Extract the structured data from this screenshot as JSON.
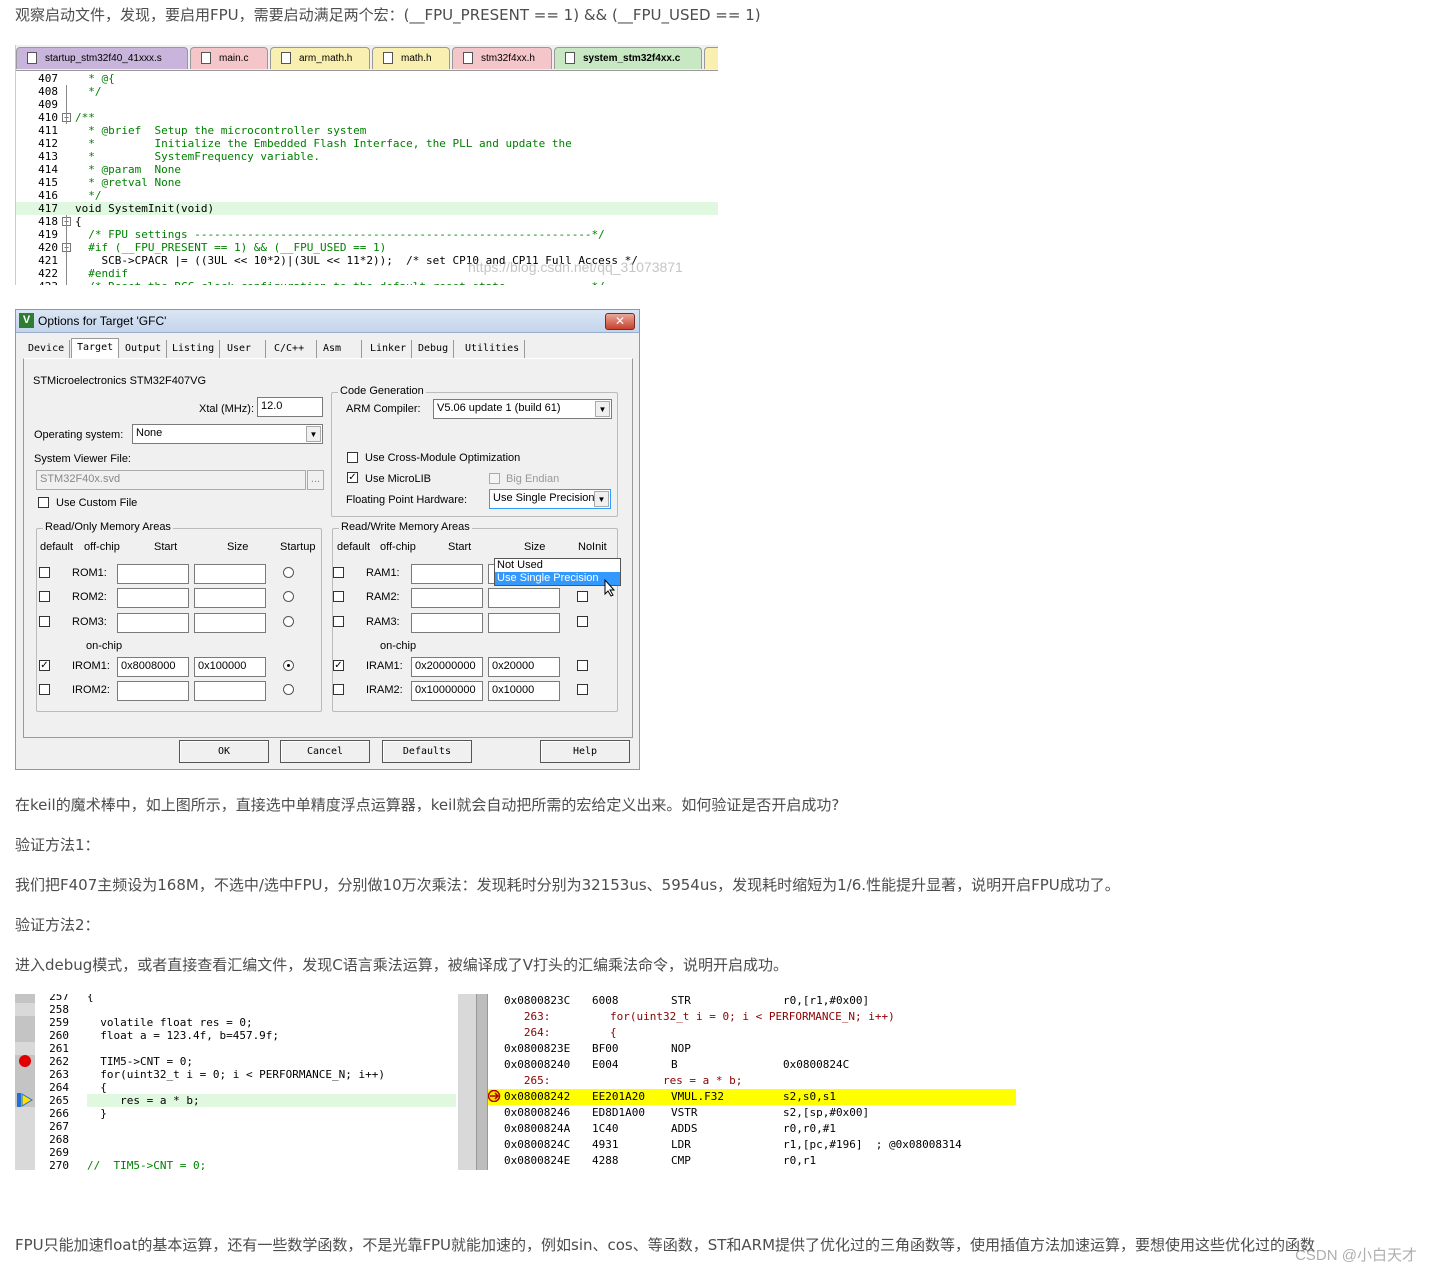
{
  "article": {
    "p1": "观察启动文件，发现，要启用FPU，需要启动满足两个宏：(__FPU_PRESENT == 1) && (__FPU_USED == 1)",
    "p2": "在keil的魔术棒中，如上图所示，直接选中单精度浮点运算器，keil就会自动把所需的宏给定义出来。如何验证是否开启成功?",
    "p3": "验证方法1：",
    "p4": "我们把F407主频设为168M，不选中/选中FPU，分别做10万次乘法：发现耗时分别为32153us、5954us，发现耗时缩短为1/6.性能提升显著，说明开启FPU成功了。",
    "p5": "验证方法2：",
    "p6": "进入debug模式，或者直接查看汇编文件，发现C语言乘法运算，被编译成了V打头的汇编乘法命令，说明开启成功。",
    "p7": "FPU只能加速float的基本运算，还有一些数学函数，不是光靠FPU就能加速的，例如sin、cos、等函数，ST和ARM提供了优化过的三角函数等，使用插值方法加速运算，要想使用这些优化过的函数",
    "watermark_csdn": "CSDN @小白天才",
    "watermark_url": "https://blog.csdn.net/qq_31073871"
  },
  "editor1": {
    "tabs": [
      {
        "label": "startup_stm32f40_41xxx.s",
        "color": "#c9b4dc"
      },
      {
        "label": "main.c",
        "color": "#f4c6c9"
      },
      {
        "label": "arm_math.h",
        "color": "#f9efb0"
      },
      {
        "label": "math.h",
        "color": "#f9efb0"
      },
      {
        "label": "stm32f4xx.h",
        "color": "#f4c6c9"
      },
      {
        "label": "system_stm32f4xx.c",
        "color": "#c8e8c4"
      }
    ],
    "lines": [
      {
        "n": "407",
        "t": "  * @{"
      },
      {
        "n": "408",
        "t": "  */"
      },
      {
        "n": "409",
        "t": ""
      },
      {
        "n": "410",
        "t": "/**"
      },
      {
        "n": "411",
        "t": "  * @brief  Setup the microcontroller system"
      },
      {
        "n": "412",
        "t": "  *         Initialize the Embedded Flash Interface, the PLL and update the"
      },
      {
        "n": "413",
        "t": "  *         SystemFrequency variable."
      },
      {
        "n": "414",
        "t": "  * @param  None"
      },
      {
        "n": "415",
        "t": "  * @retval None"
      },
      {
        "n": "416",
        "t": "  */"
      },
      {
        "n": "417",
        "t": "void SystemInit(void)"
      },
      {
        "n": "418",
        "t": "{"
      },
      {
        "n": "419",
        "t": "  /* FPU settings ------------------------------------------------------------*/"
      },
      {
        "n": "420",
        "t": "  #if (__FPU_PRESENT == 1) && (__FPU_USED == 1)"
      },
      {
        "n": "421",
        "t": "    SCB->CPACR |= ((3UL << 10*2)|(3UL << 11*2));  /* set CP10 and CP11 Full Access */"
      },
      {
        "n": "422",
        "t": "  #endif"
      },
      {
        "n": "423",
        "t": "  /* Reset the RCC clock configuration to the default reset state ------------*/"
      }
    ]
  },
  "dialog": {
    "title": "Options for Target 'GFC'",
    "close": "✕",
    "tabs": [
      "Device",
      "Target",
      "Output",
      "Listing",
      "User",
      "C/C++",
      "Asm",
      "Linker",
      "Debug",
      "Utilities"
    ],
    "device": "STMicroelectronics STM32F407VG",
    "xtal_label": "Xtal (MHz):",
    "xtal_value": "12.0",
    "os_label": "Operating system:",
    "os_value": "None",
    "svd_label": "System Viewer File:",
    "svd_value": "STM32F40x.svd",
    "svd_btn": "...",
    "custom_file": "Use Custom File",
    "codegen_title": "Code Generation",
    "compiler_label": "ARM Compiler:",
    "compiler_value": "V5.06 update 1 (build 61)",
    "cross_module": "Use Cross-Module Optimization",
    "microlib": "Use MicroLIB",
    "big_endian": "Big Endian",
    "fph_label": "Floating Point Hardware:",
    "fph_value": "Use Single Precision",
    "fph_options": [
      "Not Used",
      "Use Single Precision"
    ],
    "ro_title": "Read/Only Memory Areas",
    "rw_title": "Read/Write Memory Areas",
    "ro_headers": [
      "default",
      "off-chip",
      "Start",
      "Size",
      "Startup"
    ],
    "rw_headers": [
      "default",
      "off-chip",
      "Start",
      "Size",
      "NoInit"
    ],
    "on_chip": "on-chip",
    "ro_rows": [
      {
        "name": "ROM1:",
        "start": "",
        "size": ""
      },
      {
        "name": "ROM2:",
        "start": "",
        "size": ""
      },
      {
        "name": "ROM3:",
        "start": "",
        "size": ""
      },
      {
        "name": "IROM1:",
        "start": "0x8008000",
        "size": "0x100000"
      },
      {
        "name": "IROM2:",
        "start": "",
        "size": ""
      }
    ],
    "rw_rows": [
      {
        "name": "RAM1:",
        "start": "",
        "size": ""
      },
      {
        "name": "RAM2:",
        "start": "",
        "size": ""
      },
      {
        "name": "RAM3:",
        "start": "",
        "size": ""
      },
      {
        "name": "IRAM1:",
        "start": "0x20000000",
        "size": "0x20000"
      },
      {
        "name": "IRAM2:",
        "start": "0x10000000",
        "size": "0x10000"
      }
    ],
    "btn_ok": "OK",
    "btn_cancel": "Cancel",
    "btn_defaults": "Defaults",
    "btn_help": "Help"
  },
  "editor2": {
    "lines": [
      {
        "n": "257",
        "t": "{"
      },
      {
        "n": "258",
        "t": ""
      },
      {
        "n": "259",
        "t": "  volatile float res = 0;"
      },
      {
        "n": "260",
        "t": "  float a = 123.4f, b=457.9f;"
      },
      {
        "n": "261",
        "t": ""
      },
      {
        "n": "262",
        "t": "  TIM5->CNT = 0;"
      },
      {
        "n": "263",
        "t": "  for(uint32_t i = 0; i < PERFORMANCE_N; i++)"
      },
      {
        "n": "264",
        "t": "  {"
      },
      {
        "n": "265",
        "t": "     res = a * b;"
      },
      {
        "n": "266",
        "t": "  }"
      },
      {
        "n": "267",
        "t": ""
      },
      {
        "n": "268",
        "t": ""
      },
      {
        "n": "269",
        "t": ""
      },
      {
        "n": "270",
        "t": "//  TIM5->CNT = 0;"
      }
    ]
  },
  "disasm": {
    "lines": [
      {
        "kind": "asm",
        "addr": "0x0800823C",
        "op": "6008",
        "mn": "STR",
        "args": "r0,[r1,#0x00]"
      },
      {
        "kind": "src",
        "text": "   263:         for(uint32_t i = 0; i < PERFORMANCE_N; i++)"
      },
      {
        "kind": "src",
        "text": "   264:         {"
      },
      {
        "kind": "asm",
        "addr": "0x0800823E",
        "op": "BF00",
        "mn": "NOP",
        "args": ""
      },
      {
        "kind": "asm",
        "addr": "0x08008240",
        "op": "E004",
        "mn": "B",
        "args": "0x0800824C"
      },
      {
        "kind": "src",
        "text": "   265:                 res = a * b;"
      },
      {
        "kind": "asm",
        "addr": "0x08008242",
        "op": "EE201A20",
        "mn": "VMUL.F32",
        "args": "s2,s0,s1",
        "hl": true
      },
      {
        "kind": "asm",
        "addr": "0x08008246",
        "op": "ED8D1A00",
        "mn": "VSTR",
        "args": "s2,[sp,#0x00]"
      },
      {
        "kind": "asm",
        "addr": "0x0800824A",
        "op": "1C40",
        "mn": "ADDS",
        "args": "r0,r0,#1"
      },
      {
        "kind": "asm",
        "addr": "0x0800824C",
        "op": "4931",
        "mn": "LDR",
        "args": "r1,[pc,#196]  ; @0x08008314"
      },
      {
        "kind": "asm",
        "addr": "0x0800824E",
        "op": "4288",
        "mn": "CMP",
        "args": "r0,r1"
      }
    ]
  }
}
